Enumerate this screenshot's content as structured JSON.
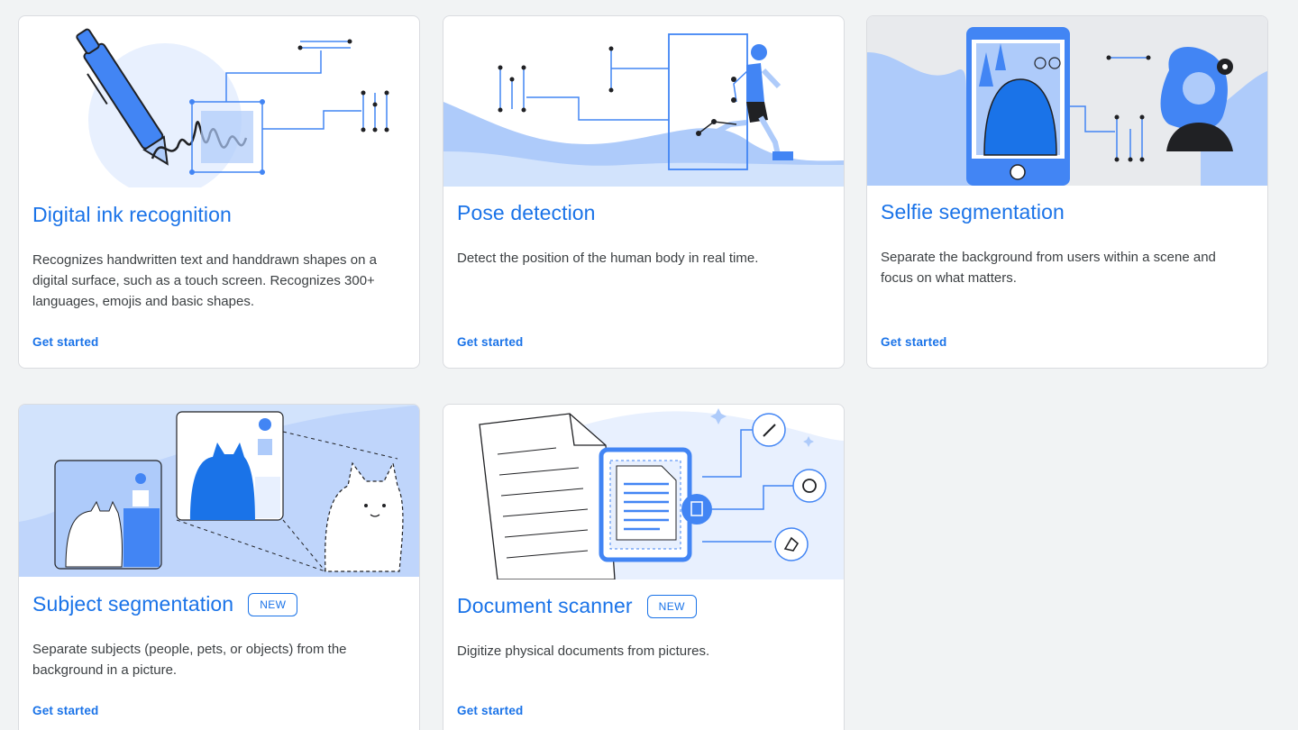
{
  "cards": [
    {
      "title": "Digital ink recognition",
      "description": "Recognizes handwritten text and handdrawn shapes on a digital surface, such as a touch screen. Recognizes 300+ languages, emojis and basic shapes.",
      "cta": "Get started"
    },
    {
      "title": "Pose detection",
      "description": "Detect the position of the human body in real time.",
      "cta": "Get started"
    },
    {
      "title": "Selfie segmentation",
      "description": "Separate the background from users within a scene and focus on what matters.",
      "cta": "Get started"
    },
    {
      "title": "Subject segmentation",
      "badge": "NEW",
      "description": "Separate subjects (people, pets, or objects) from the background in a picture.",
      "cta": "Get started"
    },
    {
      "title": "Document scanner",
      "badge": "NEW",
      "description": "Digitize physical documents from pictures.",
      "cta": "Get started"
    }
  ],
  "colors": {
    "accent": "#1a73e8",
    "illustration_blue": "#4285f4",
    "light_blue": "#aecbfa",
    "pale_blue": "#d2e3fc"
  },
  "icons": [
    "pen-icon",
    "runner-icon",
    "phone-icon",
    "cat-icon",
    "document-icon",
    "magic-wand-icon",
    "rotate-icon",
    "eraser-icon"
  ]
}
